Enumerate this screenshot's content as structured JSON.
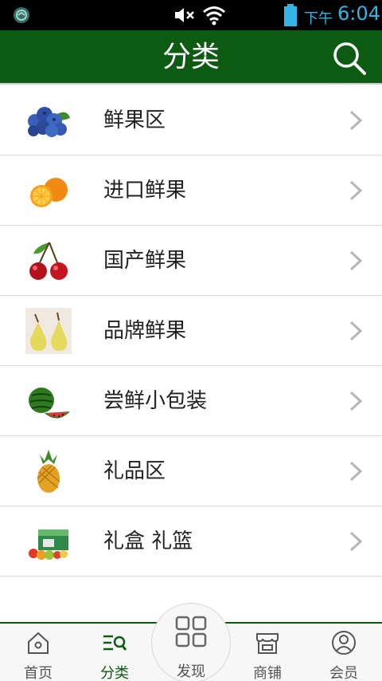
{
  "status_bar": {
    "ampm": "下午",
    "time": "6:04",
    "icons": [
      "app-shield-icon",
      "mute-icon",
      "wifi-icon",
      "battery-icon"
    ]
  },
  "header": {
    "title": "分类",
    "search_icon": "search-icon"
  },
  "categories": [
    {
      "label": "鲜果区",
      "icon": "blueberry"
    },
    {
      "label": "进口鲜果",
      "icon": "orange"
    },
    {
      "label": "国产鲜果",
      "icon": "cherry"
    },
    {
      "label": "品牌鲜果",
      "icon": "pear"
    },
    {
      "label": "尝鲜小包装",
      "icon": "watermelon"
    },
    {
      "label": "礼品区",
      "icon": "pineapple"
    },
    {
      "label": "礼盒 礼篮",
      "icon": "gift-box"
    },
    {
      "label": "",
      "icon": "kiwi"
    }
  ],
  "tabbar": {
    "home": "首页",
    "category": "分类",
    "discover": "发现",
    "shop": "商铺",
    "member": "会员"
  },
  "colors": {
    "brand_green": "#0d5a12",
    "status_blue": "#33b5e5"
  }
}
